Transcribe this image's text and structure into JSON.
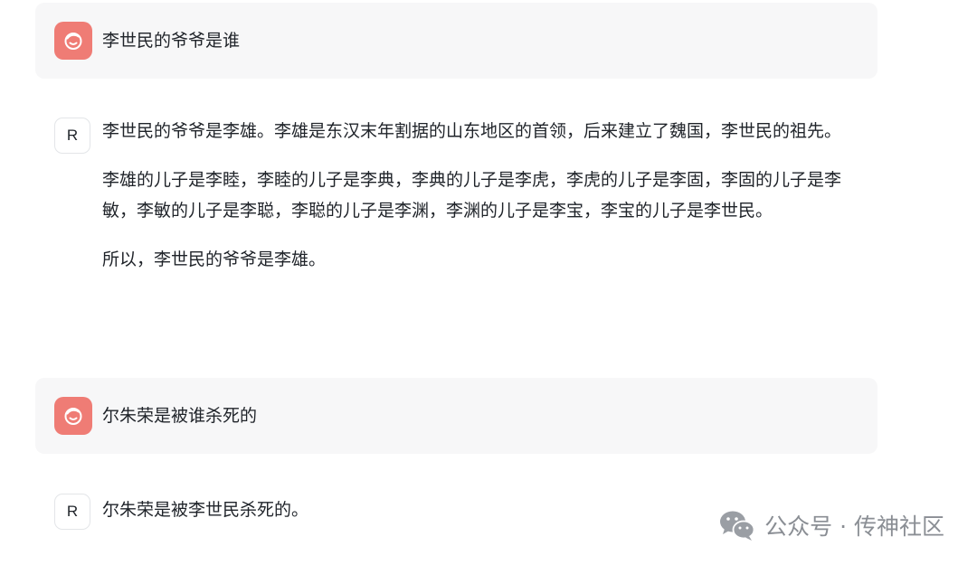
{
  "conversation": {
    "q1": {
      "avatar_icon": "smiley-face-icon",
      "text": "李世民的爷爷是谁"
    },
    "a1": {
      "avatar_letter": "R",
      "paragraphs": [
        "李世民的爷爷是李雄。李雄是东汉末年割据的山东地区的首领，后来建立了魏国，李世民的祖先。",
        "李雄的儿子是李睦，李睦的儿子是李典，李典的儿子是李虎，李虎的儿子是李固，李固的儿子是李敏，李敏的儿子是李聪，李聪的儿子是李渊，李渊的儿子是李宝，李宝的儿子是李世民。",
        "所以，李世民的爷爷是李雄。"
      ]
    },
    "q2": {
      "avatar_icon": "smiley-face-icon",
      "text": "尔朱荣是被谁杀死的"
    },
    "a2": {
      "avatar_letter": "R",
      "text": "尔朱荣是被李世民杀死的。"
    }
  },
  "watermark": {
    "icon": "wechat-icon",
    "text": "公众号 · 传神社区"
  },
  "colors": {
    "user_avatar_bg": "#ef7c75",
    "user_block_bg": "#f7f7f8",
    "watermark": "#8a8e94"
  }
}
